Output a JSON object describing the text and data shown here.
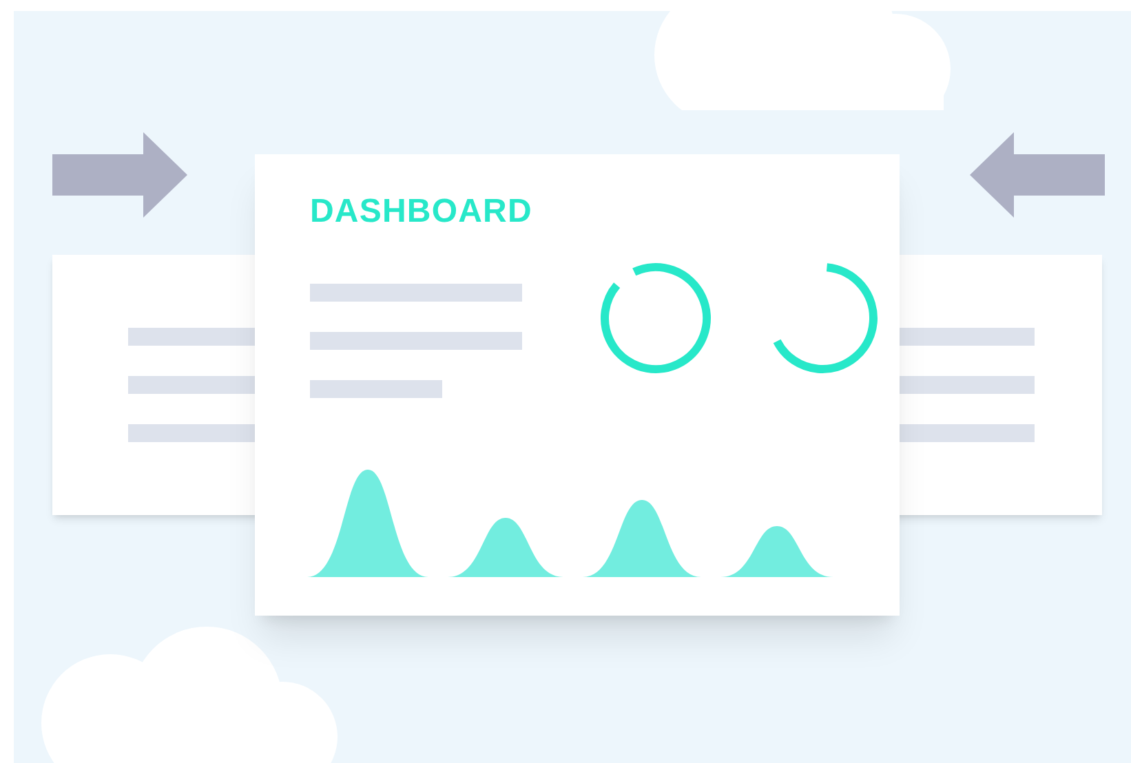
{
  "dashboard": {
    "title": "DASHBOARD",
    "rings": [
      {
        "level": 0.93
      },
      {
        "level": 0.66
      }
    ]
  }
}
